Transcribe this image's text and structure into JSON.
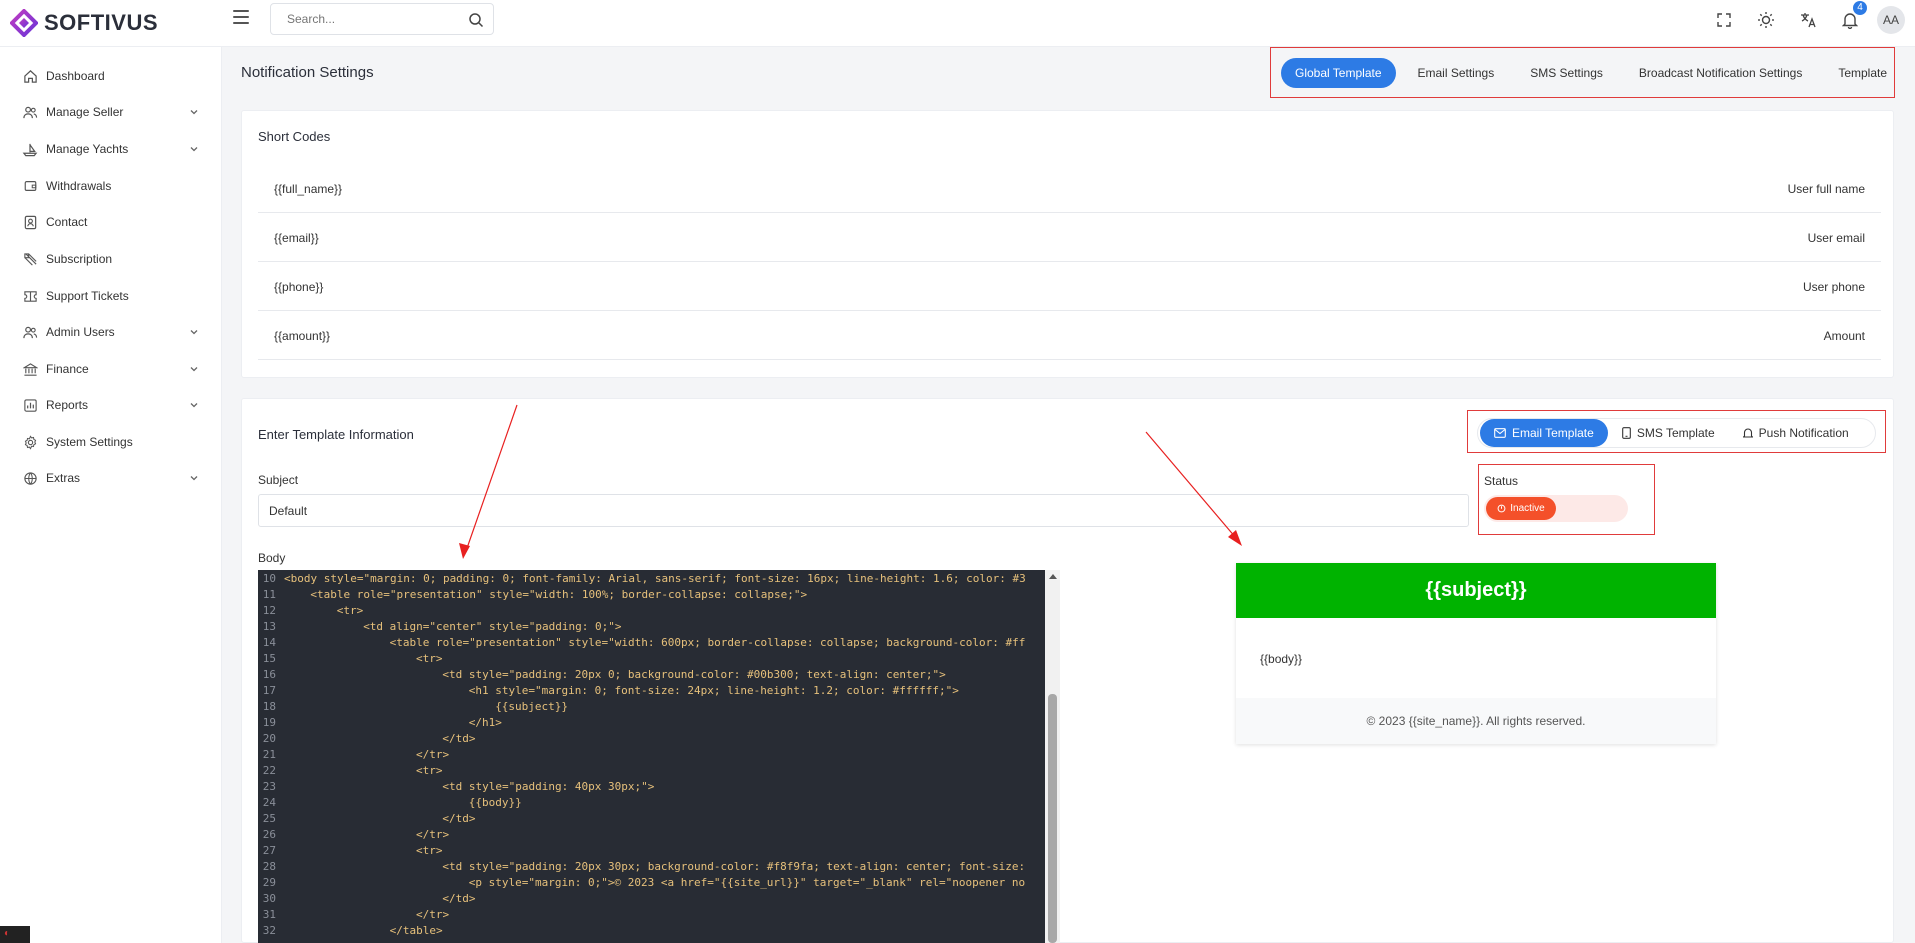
{
  "brand": {
    "name": "SOFTIVUS"
  },
  "search": {
    "placeholder": "Search..."
  },
  "header": {
    "notification_count": "4",
    "avatar_initials": "AA"
  },
  "sidebar": {
    "items": [
      {
        "label": "Dashboard",
        "icon": "home-icon",
        "has_children": false
      },
      {
        "label": "Manage Seller",
        "icon": "users-icon",
        "has_children": true
      },
      {
        "label": "Manage Yachts",
        "icon": "boat-icon",
        "has_children": true
      },
      {
        "label": "Withdrawals",
        "icon": "wallet-icon",
        "has_children": false
      },
      {
        "label": "Contact",
        "icon": "contact-icon",
        "has_children": false
      },
      {
        "label": "Subscription",
        "icon": "subscription-icon",
        "has_children": false
      },
      {
        "label": "Support Tickets",
        "icon": "ticket-icon",
        "has_children": false
      },
      {
        "label": "Admin Users",
        "icon": "admin-users-icon",
        "has_children": true
      },
      {
        "label": "Finance",
        "icon": "bank-icon",
        "has_children": true
      },
      {
        "label": "Reports",
        "icon": "report-icon",
        "has_children": true
      },
      {
        "label": "System Settings",
        "icon": "gear-icon",
        "has_children": false
      },
      {
        "label": "Extras",
        "icon": "globe-icon",
        "has_children": true
      }
    ]
  },
  "page": {
    "title": "Notification Settings"
  },
  "settings_tabs": [
    {
      "label": "Global Template",
      "active": true
    },
    {
      "label": "Email Settings",
      "active": false
    },
    {
      "label": "SMS Settings",
      "active": false
    },
    {
      "label": "Broadcast Notification Settings",
      "active": false
    },
    {
      "label": "Template",
      "active": false
    }
  ],
  "short_codes": {
    "title": "Short Codes",
    "rows": [
      {
        "code": "{{full_name}}",
        "description": "User full name"
      },
      {
        "code": "{{email}}",
        "description": "User email"
      },
      {
        "code": "{{phone}}",
        "description": "User phone"
      },
      {
        "code": "{{amount}}",
        "description": "Amount"
      }
    ]
  },
  "template_form": {
    "title": "Enter Template Information",
    "tabs": [
      {
        "label": "Email Template",
        "icon": "mail-icon",
        "active": true
      },
      {
        "label": "SMS Template",
        "icon": "phone-icon",
        "active": false
      },
      {
        "label": "Push Notification",
        "icon": "bell-icon",
        "active": false
      }
    ],
    "subject_label": "Subject",
    "subject_value": "Default",
    "status_label": "Status",
    "status_value": "Inactive",
    "body_label": "Body"
  },
  "code_lines": [
    {
      "n": "10",
      "indent": 0,
      "text": "<body style=\"margin: 0; padding: 0; font-family: Arial, sans-serif; font-size: 16px; line-height: 1.6; color: #3"
    },
    {
      "n": "11",
      "indent": 4,
      "text": "<table role=\"presentation\" style=\"width: 100%; border-collapse: collapse;\">"
    },
    {
      "n": "12",
      "indent": 8,
      "text": "<tr>"
    },
    {
      "n": "13",
      "indent": 12,
      "text": "<td align=\"center\" style=\"padding: 0;\">"
    },
    {
      "n": "14",
      "indent": 16,
      "text": "<table role=\"presentation\" style=\"width: 600px; border-collapse: collapse; background-color: #ff"
    },
    {
      "n": "15",
      "indent": 20,
      "text": "<tr>"
    },
    {
      "n": "16",
      "indent": 24,
      "text": "<td style=\"padding: 20px 0; background-color: #00b300; text-align: center;\">"
    },
    {
      "n": "17",
      "indent": 28,
      "text": "<h1 style=\"margin: 0; font-size: 24px; line-height: 1.2; color: #ffffff;\">"
    },
    {
      "n": "18",
      "indent": 32,
      "text": "{{subject}}"
    },
    {
      "n": "19",
      "indent": 28,
      "text": "</h1>"
    },
    {
      "n": "20",
      "indent": 24,
      "text": "</td>"
    },
    {
      "n": "21",
      "indent": 20,
      "text": "</tr>"
    },
    {
      "n": "22",
      "indent": 20,
      "text": "<tr>"
    },
    {
      "n": "23",
      "indent": 24,
      "text": "<td style=\"padding: 40px 30px;\">"
    },
    {
      "n": "24",
      "indent": 28,
      "text": "{{body}}"
    },
    {
      "n": "25",
      "indent": 24,
      "text": "</td>"
    },
    {
      "n": "26",
      "indent": 20,
      "text": "</tr>"
    },
    {
      "n": "27",
      "indent": 20,
      "text": "<tr>"
    },
    {
      "n": "28",
      "indent": 24,
      "text": "<td style=\"padding: 20px 30px; background-color: #f8f9fa; text-align: center; font-size:"
    },
    {
      "n": "29",
      "indent": 28,
      "text": "<p style=\"margin: 0;\">© 2023 <a href=\"{{site_url}}\" target=\"_blank\" rel=\"noopener no"
    },
    {
      "n": "30",
      "indent": 24,
      "text": "</td>"
    },
    {
      "n": "31",
      "indent": 20,
      "text": "</tr>"
    },
    {
      "n": "32",
      "indent": 16,
      "text": "</table>"
    }
  ],
  "preview": {
    "subject": "{{subject}}",
    "body": "{{body}}",
    "footer": "© 2023 {{site_name}}. All rights reserved."
  },
  "colors": {
    "primary": "#2d7be5",
    "danger_outline": "#e03b3b",
    "inactive": "#f4502a",
    "preview_header": "#00b300",
    "editor_bg": "#282c34"
  }
}
